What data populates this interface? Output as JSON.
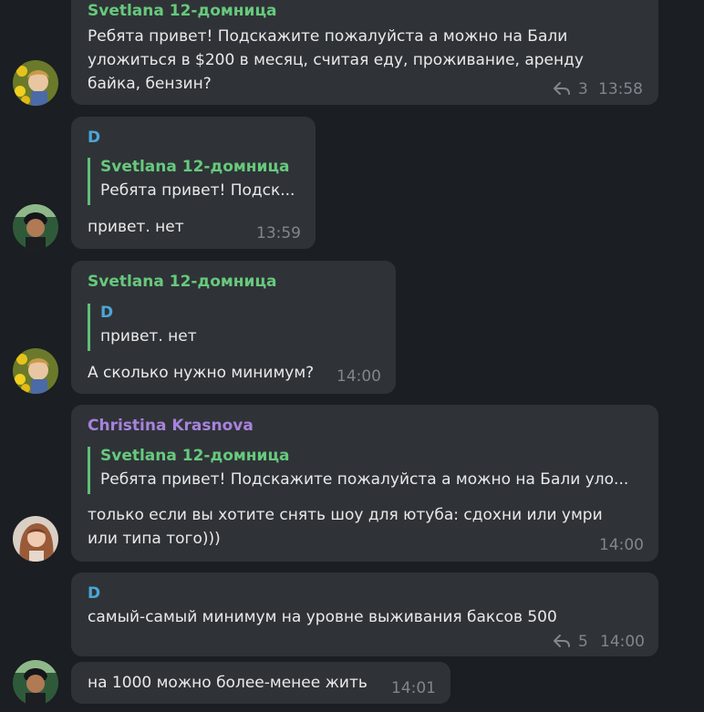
{
  "colors": {
    "background": "#1b1e22",
    "bubble": "#2f3337",
    "svetlana": "#67c97d",
    "d": "#4ba6d8",
    "christina": "#a882dd",
    "quote_bar": "#5fbf7a",
    "meta": "#7f868d"
  },
  "messages": [
    {
      "sender": "Svetlana 12-домница",
      "lines": [
        "Ребята привет! Подскажите пожалуйста а можно на Бали",
        "уложиться в  $200 в месяц, считая еду, проживание, аренду",
        "байка, бензин?"
      ],
      "replies": "3",
      "time": "13:58",
      "avatar_icon": "avatar-svetlana-icon"
    },
    {
      "sender": "D",
      "quote": {
        "name": "Svetlana 12-домница",
        "text": "Ребята привет! Подск..."
      },
      "lines": [
        "привет. нет"
      ],
      "time": "13:59",
      "avatar_icon": "avatar-d-icon"
    },
    {
      "sender": "Svetlana 12-домница",
      "quote": {
        "name": "D",
        "text": "привет. нет"
      },
      "lines": [
        "А сколько нужно минимум?"
      ],
      "time": "14:00",
      "avatar_icon": "avatar-svetlana-icon"
    },
    {
      "sender": "Christina Krasnova",
      "quote": {
        "name": "Svetlana 12-домница",
        "text": "Ребята привет! Подскажите пожалуйста а можно на Бали уло..."
      },
      "lines": [
        "только если вы хотите снять шоу для ютуба: сдохни или умри",
        "или типа того)))"
      ],
      "time": "14:00",
      "avatar_icon": "avatar-christina-icon"
    },
    {
      "sender": "D",
      "lines": [
        "самый-самый минимум на уровне выживания баксов 500"
      ],
      "replies": "5",
      "time": "14:00"
    },
    {
      "lines": [
        "на 1000 можно более-менее жить"
      ],
      "time": "14:01",
      "avatar_icon": "avatar-d-icon"
    }
  ]
}
